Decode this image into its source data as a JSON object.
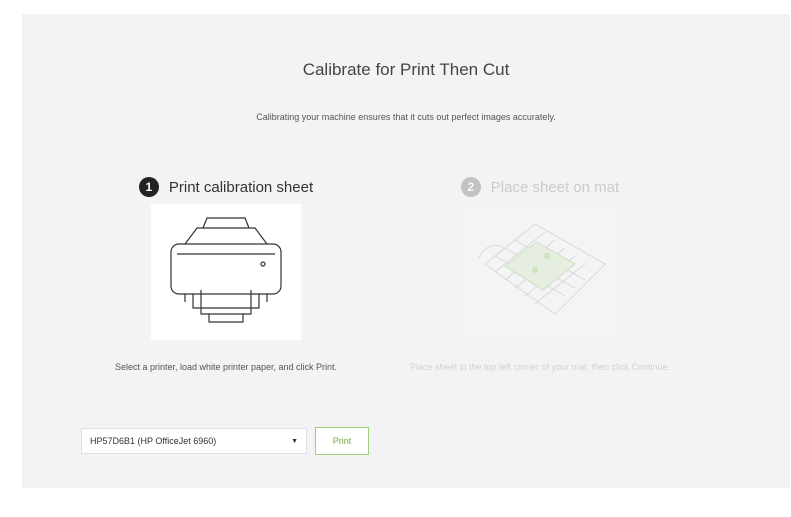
{
  "dialog": {
    "title": "Calibrate for Print Then Cut",
    "subtitle": "Calibrating your machine ensures that it cuts out perfect images accurately."
  },
  "steps": [
    {
      "number": "1",
      "title": "Print calibration sheet",
      "image": "printer-illustration",
      "description": "Select a printer, load white printer paper, and click Print."
    },
    {
      "number": "2",
      "title": "Place sheet on mat",
      "image": "mat-illustration",
      "description": "Place sheet in the top left corner of your mat, then click Continue."
    }
  ],
  "printer": {
    "selected": "HP57D6B1 (HP OfficeJet 6960)",
    "caret_icon": "chevron-down-icon"
  },
  "print_button_label": "Print",
  "colors": {
    "panel_bg": "#f3f3f6",
    "accent_green": "#6aaa3a",
    "step_active": "#222222",
    "step_inactive": "#8a8a8a"
  }
}
